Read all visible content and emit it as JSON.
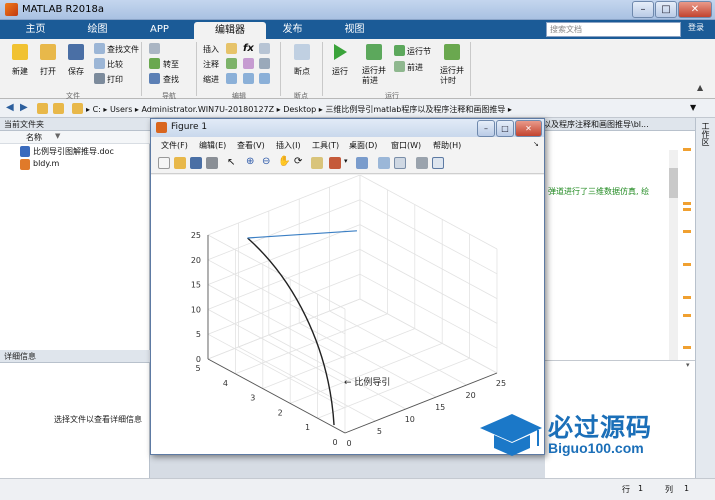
{
  "window": {
    "title": "MATLAB R2018a"
  },
  "tabs": [
    "主页",
    "绘图",
    "APP",
    "编辑器",
    "发布",
    "视图"
  ],
  "active_tab": "编辑器",
  "search": {
    "placeholder": "搜索文档"
  },
  "login": "登录",
  "ribbon": {
    "file": {
      "new": "新建",
      "open": "打开",
      "save": "保存",
      "find_files": "查找文件",
      "compare": "比较",
      "print": "打印",
      "group": "文件"
    },
    "nav": {
      "goto": "转至",
      "find": "查找",
      "group": "导航"
    },
    "edit": {
      "insert": "插入",
      "comment": "注释",
      "indent": "缩进",
      "fx": "fx",
      "group": "编辑"
    },
    "breakpoints": {
      "label": "断点",
      "group": "断点"
    },
    "run": {
      "run": "运行",
      "run_advance": "运行并\n前进",
      "run_section": "运行节",
      "advance": "前进",
      "run_time": "运行并\n计时",
      "group": "运行"
    }
  },
  "address": {
    "parts": [
      "C:",
      "Users",
      "Administrator.WIN7U-20180127Z",
      "Desktop",
      "三维比例导引matlab程序以及程序注释和画图推导"
    ]
  },
  "current_folder": {
    "title": "当前文件夹",
    "name_col": "名称",
    "files": [
      "比例导引图解推导.doc",
      "bldy.m"
    ]
  },
  "details": {
    "title": "详细信息",
    "message": "选择文件以查看详细信息"
  },
  "editor": {
    "tab_path": "以及程序注释和画图推导\\bl...",
    "code_comment": "弹道进行了三维数据仿真, 绘"
  },
  "workspace_tab": "工作区",
  "figure": {
    "title": "Figure 1",
    "menu": [
      "文件(F)",
      "编辑(E)",
      "查看(V)",
      "插入(I)",
      "工具(T)",
      "桌面(D)",
      "窗口(W)",
      "帮助(H)"
    ],
    "z_ticks": [
      "0",
      "5",
      "10",
      "15",
      "20",
      "25"
    ],
    "y_ticks": [
      "0",
      "1",
      "2",
      "3",
      "4",
      "5"
    ],
    "x_ticks": [
      "0",
      "5",
      "10",
      "15",
      "20",
      "25"
    ],
    "annotation": "比例导引"
  },
  "status": {
    "row_label": "行",
    "row": "1",
    "col_label": "列",
    "col": "1"
  },
  "watermark": {
    "line1": "必过源码",
    "line2": "Biguo100.com"
  }
}
